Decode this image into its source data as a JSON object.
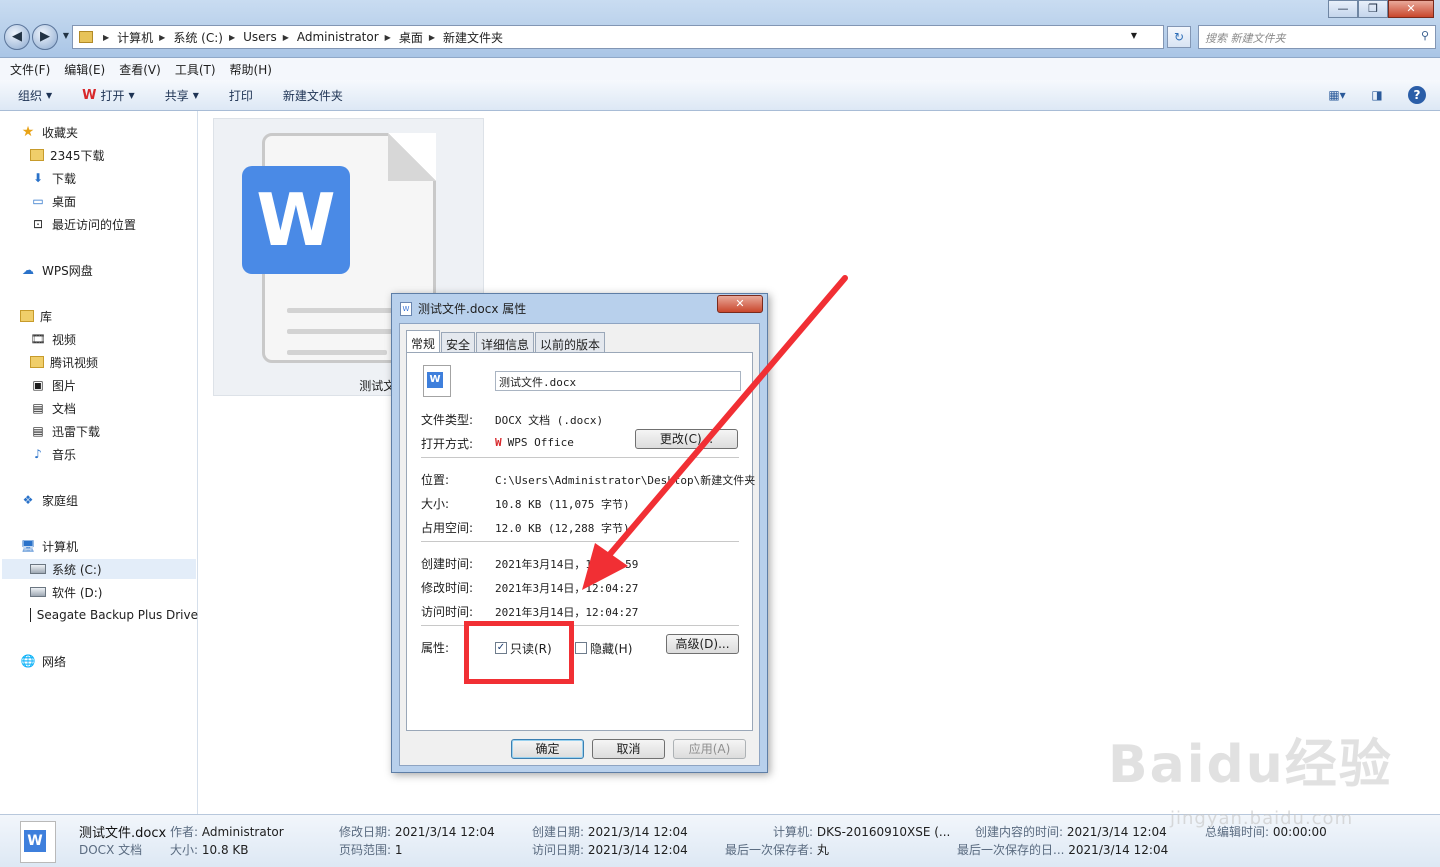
{
  "window": {
    "controls": {
      "minimize": "—",
      "maximize": "❐",
      "close": "✕"
    },
    "breadcrumbs": [
      "计算机",
      "系统 (C:)",
      "Users",
      "Administrator",
      "桌面",
      "新建文件夹"
    ],
    "search_placeholder": "搜索 新建文件夹"
  },
  "menu": [
    "文件(F)",
    "编辑(E)",
    "查看(V)",
    "工具(T)",
    "帮助(H)"
  ],
  "toolbar": {
    "organize": "组织",
    "open": "打开",
    "share": "共享",
    "print": "打印",
    "new_folder": "新建文件夹",
    "wps_glyph": "W"
  },
  "sidebar": {
    "favorites": "收藏夹",
    "fav_items": [
      "2345下载",
      "下载",
      "桌面",
      "最近访问的位置"
    ],
    "wps": "WPS网盘",
    "library": "库",
    "lib_items": [
      "视频",
      "腾讯视频",
      "图片",
      "文档",
      "迅雷下载",
      "音乐"
    ],
    "homegroup": "家庭组",
    "computer": "计算机",
    "drives": [
      "系统 (C:)",
      "软件 (D:)",
      "Seagate Backup Plus Drive"
    ],
    "network": "网络"
  },
  "file": {
    "name": "测试文件.docx",
    "logo": "W"
  },
  "dialog": {
    "title": "测试文件.docx 属性",
    "tabs": [
      "常规",
      "安全",
      "详细信息",
      "以前的版本"
    ],
    "filename": "测试文件.docx",
    "type_label": "文件类型:",
    "type_value": "DOCX 文档 (.docx)",
    "open_label": "打开方式:",
    "open_value": "WPS Office",
    "change_btn": "更改(C)...",
    "location_label": "位置:",
    "location_value": "C:\\Users\\Administrator\\Desktop\\新建文件夹",
    "size_label": "大小:",
    "size_value": "10.8 KB (11,075 字节)",
    "disk_label": "占用空间:",
    "disk_value": "12.0 KB (12,288 字节)",
    "created_label": "创建时间:",
    "created_value": "2021年3月14日，12:04:59",
    "modified_label": "修改时间:",
    "modified_value": "2021年3月14日，12:04:27",
    "accessed_label": "访问时间:",
    "accessed_value": "2021年3月14日，12:04:27",
    "attr_label": "属性:",
    "readonly": "只读(R)",
    "hidden": "隐藏(H)",
    "advanced_btn": "高级(D)...",
    "ok": "确定",
    "cancel": "取消",
    "apply": "应用(A)",
    "close": "✕",
    "checkmark": "✓"
  },
  "details": {
    "name": "测试文件.docx",
    "type": "DOCX 文档",
    "author_k": "作者:",
    "author_v": "Administrator",
    "size_k": "大小:",
    "size_v": "10.8 KB",
    "mod_k": "修改日期:",
    "mod_v": "2021/3/14 12:04",
    "pages_k": "页码范围:",
    "pages_v": "1",
    "created_k": "创建日期:",
    "created_v": "2021/3/14 12:04",
    "access_k": "访问日期:",
    "access_v": "2021/3/14 12:04",
    "computer_k": "计算机:",
    "computer_v": "DKS-20160910XSE (...",
    "saver_k": "最后一次保存者:",
    "saver_v": "丸",
    "content_created_k": "创建内容的时间:",
    "content_created_v": "2021/3/14 12:04",
    "last_saved_k": "最后一次保存的日...",
    "last_saved_v": "2021/3/14 12:04",
    "edit_time_k": "总编辑时间:",
    "edit_time_v": "00:00:00"
  },
  "watermark": {
    "brand": "Baidu经验",
    "url": "jingyan.baidu.com"
  },
  "colors": {
    "accent": "#f12f34",
    "wps_blue": "#4a8ae6"
  }
}
